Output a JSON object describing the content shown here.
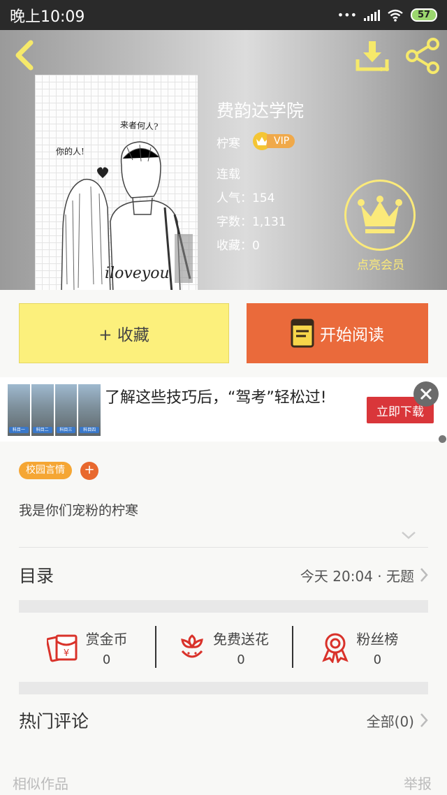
{
  "status_bar": {
    "time": "晚上10:09",
    "dots": "•••",
    "battery": "57"
  },
  "book": {
    "title": "费韵达学院",
    "author": "柠寒",
    "vip": "VIP",
    "status": "连载",
    "popularity": "人气：154",
    "word_count": "字数：1,131",
    "favorites": "收藏：0",
    "cover_text": {
      "top": "来者何人?",
      "left": "你的人!",
      "bottom": "iloveyou"
    }
  },
  "member": {
    "label": "点亮会员"
  },
  "actions": {
    "collect": "+ 收藏",
    "read": "开始阅读"
  },
  "ad": {
    "text": "了解这些技巧后，“驾考”轻松过!",
    "download": "立即下载",
    "panel_labels": [
      "科目一",
      "科目二",
      "科目三",
      "科目四"
    ]
  },
  "tags": {
    "genre": "校园言情",
    "add": "+"
  },
  "description": "我是你们宠粉的柠寒",
  "catalog": {
    "title": "目录",
    "latest": "今天 20:04 · 无题"
  },
  "stats": [
    {
      "label": "赏金币",
      "value": "0",
      "icon": "red-envelope-icon"
    },
    {
      "label": "免费送花",
      "value": "0",
      "icon": "flower-icon"
    },
    {
      "label": "粉丝榜",
      "value": "0",
      "icon": "medal-icon"
    }
  ],
  "comments": {
    "title": "热门评论",
    "all": "全部(0)"
  },
  "footer": {
    "similar": "相似作品",
    "report": "举报"
  },
  "colors": {
    "yellow": "#fcf07c",
    "orange": "#ea6a3b",
    "tag": "#f5a634",
    "red_icon": "#d9322a"
  }
}
